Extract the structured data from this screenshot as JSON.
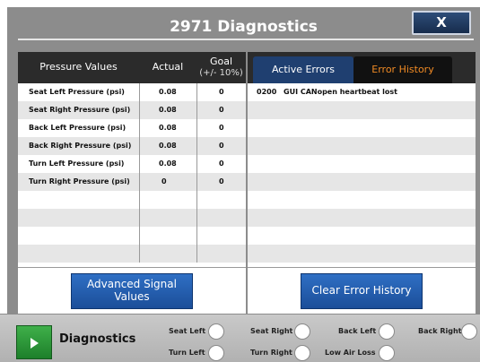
{
  "window": {
    "title": "2971 Diagnostics",
    "close_label": "X"
  },
  "pressure_table": {
    "headers": {
      "name": "Pressure Values",
      "actual": "Actual",
      "goal_line1": "Goal",
      "goal_line2": "(+/- 10%)"
    },
    "rows": [
      {
        "name": "Seat Left Pressure (psi)",
        "actual": "0.08",
        "goal": "0"
      },
      {
        "name": "Seat Right Pressure (psi)",
        "actual": "0.08",
        "goal": "0"
      },
      {
        "name": "Back Left Pressure (psi)",
        "actual": "0.08",
        "goal": "0"
      },
      {
        "name": "Back Right Pressure (psi)",
        "actual": "0.08",
        "goal": "0"
      },
      {
        "name": "Turn Left Pressure (psi)",
        "actual": "0.08",
        "goal": "0"
      },
      {
        "name": "Turn Right Pressure (psi)",
        "actual": "0",
        "goal": "0"
      }
    ],
    "button_label_line1": "Advanced Signal",
    "button_label_line2": "Values"
  },
  "errors": {
    "tabs": {
      "active": "Active Errors",
      "history": "Error History"
    },
    "rows": [
      {
        "code": "0200",
        "message": "GUI CANopen heartbeat lost"
      }
    ],
    "clear_button_label": "Clear Error History"
  },
  "bottom_bar": {
    "diagnostics_label": "Diagnostics",
    "indicators": {
      "seat_left": "Seat Left",
      "seat_right": "Seat Right",
      "back_left": "Back Left",
      "back_right": "Back Right",
      "turn_left": "Turn Left",
      "turn_right": "Turn Right",
      "low_air_loss": "Low Air Loss"
    }
  }
}
